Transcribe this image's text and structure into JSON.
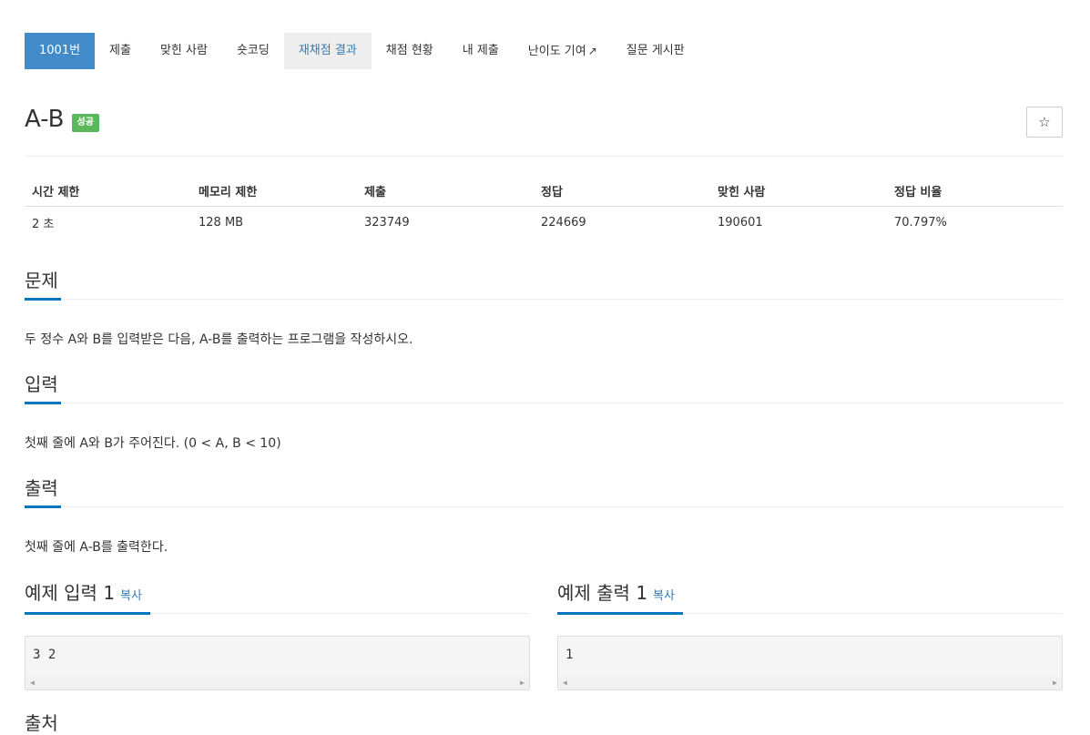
{
  "tabs": [
    {
      "label": "1001번"
    },
    {
      "label": "제출"
    },
    {
      "label": "맞힌 사람"
    },
    {
      "label": "숏코딩"
    },
    {
      "label": "재채점 결과"
    },
    {
      "label": "채점 현황"
    },
    {
      "label": "내 제출"
    },
    {
      "label": "난이도 기여",
      "icon": "external-link-icon"
    },
    {
      "label": "질문 게시판"
    }
  ],
  "problem": {
    "title": "A-B",
    "status_badge": "성공",
    "star_icon": "star-icon"
  },
  "info_table": {
    "headers": [
      "시간 제한",
      "메모리 제한",
      "제출",
      "정답",
      "맞힌 사람",
      "정답 비율"
    ],
    "values": [
      "2 초",
      "128 MB",
      "323749",
      "224669",
      "190601",
      "70.797%"
    ]
  },
  "sections": {
    "problem": {
      "heading": "문제",
      "body": "두 정수 A와 B를 입력받은 다음, A-B를 출력하는 프로그램을 작성하시오."
    },
    "input": {
      "heading": "입력",
      "body": "첫째 줄에 A와 B가 주어진다. (0 < A, B < 10)"
    },
    "output": {
      "heading": "출력",
      "body": "첫째 줄에 A-B를 출력한다."
    }
  },
  "examples": {
    "input": {
      "heading": "예제 입력 1",
      "copy_label": "복사",
      "content": "3 2"
    },
    "output": {
      "heading": "예제 출력 1",
      "copy_label": "복사",
      "content": "1"
    }
  },
  "next_section": {
    "heading": "출처"
  },
  "colors": {
    "accent": "#428bca",
    "success": "#5cb85c",
    "underline": "#0076c0",
    "link": "#337ab7"
  }
}
